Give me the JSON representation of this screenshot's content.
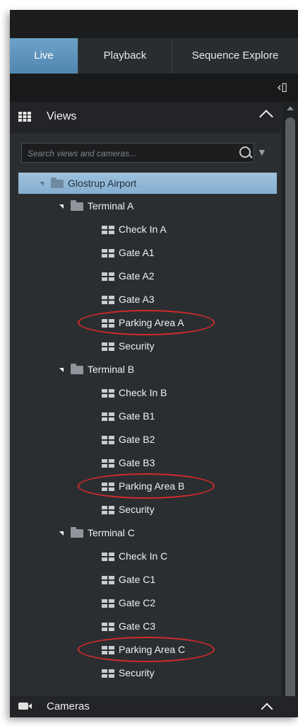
{
  "tabs": [
    {
      "label": "Live",
      "active": true
    },
    {
      "label": "Playback",
      "active": false
    },
    {
      "label": "Sequence Explore",
      "active": false
    }
  ],
  "views_panel": {
    "title": "Views",
    "search_placeholder": "Search views and cameras...",
    "tree": {
      "root": "Glostrup Airport",
      "terminals": [
        {
          "label": "Terminal A",
          "views": [
            "Check In A",
            "Gate A1",
            "Gate A2",
            "Gate A3",
            "Parking Area A",
            "Security"
          ]
        },
        {
          "label": "Terminal B",
          "views": [
            "Check In B",
            "Gate B1",
            "Gate B2",
            "Gate B3",
            "Parking Area B",
            "Security"
          ]
        },
        {
          "label": "Terminal C",
          "views": [
            "Check In C",
            "Gate C1",
            "Gate C2",
            "Gate C3",
            "Parking Area C",
            "Security"
          ]
        }
      ]
    },
    "highlighted_views": [
      "Parking Area A",
      "Parking Area B",
      "Parking Area C"
    ]
  },
  "cameras_panel": {
    "title": "Cameras"
  },
  "colors": {
    "highlight_ring": "#d42a2a",
    "selected_root": "#9ec2de",
    "active_tab": "#5a8fba"
  }
}
